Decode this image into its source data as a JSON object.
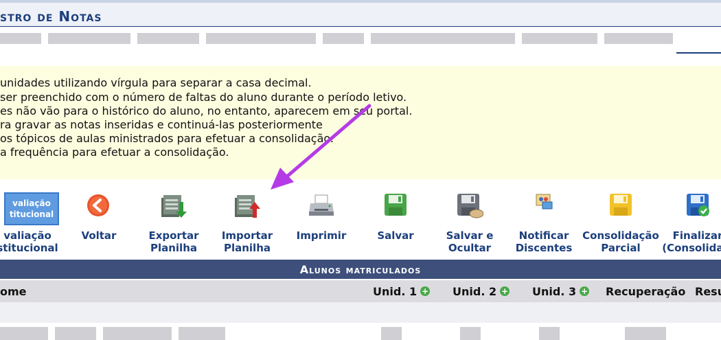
{
  "page": {
    "title": "stro de Notas"
  },
  "info_lines": [
    "unidades utilizando vírgula para separar a casa decimal.",
    " ser preenchido com o número de faltas do aluno durante o período letivo.",
    "es não vão para o histórico do aluno, no entanto, aparecem em seu portal.",
    "ra gravar as notas inseridas e continuá-las posteriormente",
    "os tópicos de aulas ministrados para efetuar a consolidação.",
    "a frequência para efetuar a consolidação."
  ],
  "toolbar": {
    "items": [
      {
        "line1": "valiação",
        "line2": "stitucional",
        "icon": "avaliacao-institucional-icon"
      },
      {
        "line1": "Voltar",
        "line2": "",
        "icon": "back-arrow-icon"
      },
      {
        "line1": "Exportar",
        "line2": "Planilha",
        "icon": "export-spreadsheet-icon"
      },
      {
        "line1": "Importar",
        "line2": "Planilha",
        "icon": "import-spreadsheet-icon"
      },
      {
        "line1": "Imprimir",
        "line2": "",
        "icon": "printer-icon"
      },
      {
        "line1": "Salvar",
        "line2": "",
        "icon": "save-icon"
      },
      {
        "line1": "Salvar e",
        "line2": "Ocultar",
        "icon": "save-hide-icon"
      },
      {
        "line1": "Notificar",
        "line2": "Discentes",
        "icon": "notify-students-icon"
      },
      {
        "line1": "Consolidação",
        "line2": "Parcial",
        "icon": "partial-consolidation-icon"
      },
      {
        "line1": "Finalizar",
        "line2": "(Consolidar)",
        "icon": "finalize-consolidate-icon"
      }
    ]
  },
  "section": {
    "title": "Alunos matriculados"
  },
  "table": {
    "columns": {
      "name": "ome",
      "unid1": "Unid. 1",
      "unid2": "Unid. 2",
      "unid3": "Unid. 3",
      "recuperacao": "Recuperação",
      "resultado": "Resu"
    }
  },
  "colors": {
    "accent": "#1c3f7c",
    "info_bg": "#fdfde0",
    "section_bg": "#3d4f7a",
    "annotation_arrow": "#b43be6"
  }
}
